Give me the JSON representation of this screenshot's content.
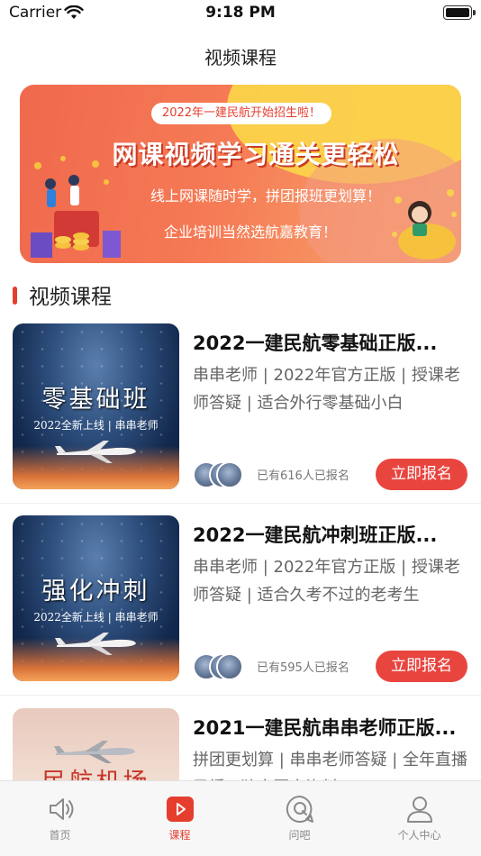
{
  "status_bar": {
    "carrier": "Carrier",
    "time": "9:18 PM"
  },
  "nav": {
    "title": "视频课程"
  },
  "banner": {
    "pill_text": "2022年一建民航开始招生啦！",
    "headline": "网课视频学习通关更轻松",
    "line1": "线上网课随时学，拼团报班更划算！",
    "line2": "企业培训当然选航嘉教育！"
  },
  "section": {
    "title": "视频课程"
  },
  "courses": [
    {
      "thumb_title": "零基础班",
      "thumb_sub": "2022全新上线 | 串串老师",
      "title": "2022一建民航零基础正版...",
      "desc": "串串老师 | 2022年官方正版 | 授课老师答疑 | 适合外行零基础小白",
      "enrolled": "已有616人已报名",
      "button": "立即报名"
    },
    {
      "thumb_title": "强化冲刺",
      "thumb_sub": "2022全新上线 | 串串老师",
      "title": "2022一建民航冲刺班正版...",
      "desc": "串串老师 | 2022年官方正版 | 授课老师答疑 | 适合久考不过的老考生",
      "enrolled": "已有595人已报名",
      "button": "立即报名"
    },
    {
      "thumb_title": "民航机场",
      "title": "2021一建民航串串老师正版...",
      "desc": "拼团更划算 | 串串老师答疑 | 全年直播 录播 | 独家图文资料"
    }
  ],
  "tabbar": {
    "tabs": [
      {
        "label": "首页",
        "icon": "speaker-icon",
        "active": false
      },
      {
        "label": "课程",
        "icon": "play-icon",
        "active": true
      },
      {
        "label": "问吧",
        "icon": "question-icon",
        "active": false
      },
      {
        "label": "个人中心",
        "icon": "person-icon",
        "active": false
      }
    ]
  },
  "colors": {
    "accent": "#e53e2e",
    "button": "#e9453f",
    "inactive_tab": "#8a8a8a"
  }
}
